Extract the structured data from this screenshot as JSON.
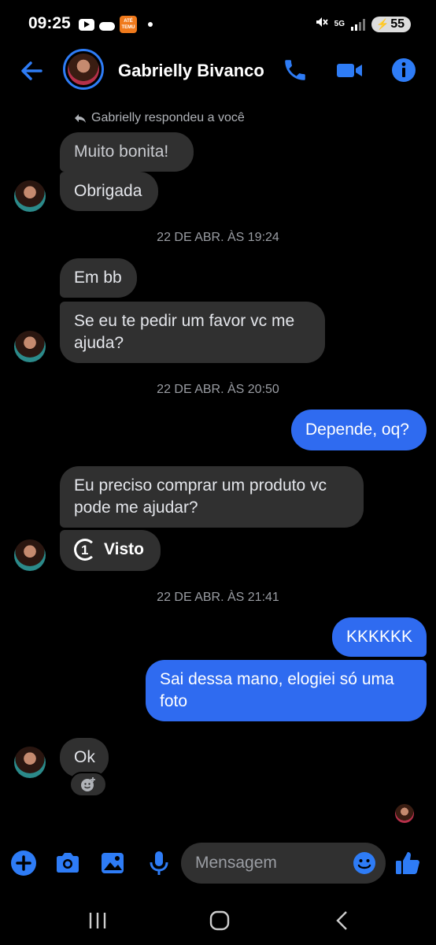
{
  "status_bar": {
    "time": "09:25",
    "temu_label": "Até 90% OFF TEMU",
    "network": "5G",
    "battery": "55"
  },
  "header": {
    "contact_name": "Gabrielly Bivanco",
    "icons": [
      "back-arrow-icon",
      "phone-icon",
      "video-camera-icon",
      "info-icon"
    ],
    "accent_color": "#2e7cf6"
  },
  "thread": {
    "reply_note": "Gabrielly respondeu a você",
    "messages": [
      {
        "from": "them",
        "text": "Muito bonita!"
      },
      {
        "from": "them",
        "text": "Obrigada"
      },
      {
        "type": "timestamp",
        "text": "22 DE ABR. ÀS 19:24"
      },
      {
        "from": "them",
        "text": "Em bb"
      },
      {
        "from": "them",
        "text": "Se eu te pedir um favor vc me ajuda?"
      },
      {
        "type": "timestamp",
        "text": "22 DE ABR. ÀS 20:50"
      },
      {
        "from": "me",
        "text": "Depende, oq?"
      },
      {
        "from": "them",
        "text": "Eu preciso comprar um produto vc pode me ajudar?"
      },
      {
        "from": "them",
        "text": "Visto",
        "kind": "view-once"
      },
      {
        "type": "timestamp",
        "text": "22 DE ABR. ÀS 21:41"
      },
      {
        "from": "me",
        "text": "KKKKKK"
      },
      {
        "from": "me",
        "text": "Sai dessa mano, elogiei só uma foto"
      },
      {
        "from": "them",
        "text": "Ok"
      }
    ]
  },
  "composer": {
    "placeholder": "Mensagem",
    "icons": [
      "plus-icon",
      "camera-icon",
      "gallery-icon",
      "microphone-icon",
      "emoji-icon",
      "thumbs-up-icon"
    ]
  },
  "navbar": {
    "icons": [
      "recent-apps-icon",
      "home-icon",
      "back-icon"
    ]
  }
}
